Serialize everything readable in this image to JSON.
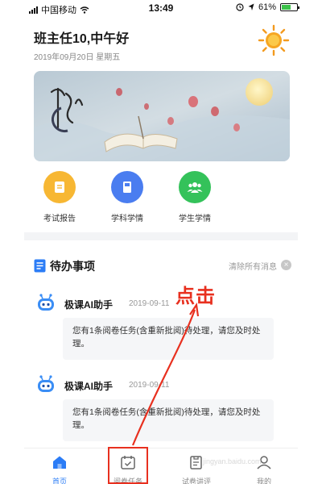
{
  "status_bar": {
    "carrier": "中国移动",
    "time": "13:49",
    "battery": "61%",
    "battery_level": 0.61
  },
  "header": {
    "greeting": "班主任10,中午好",
    "date": "2019年09月20日 星期五"
  },
  "banner": {
    "icon": "mid-autumn-banner"
  },
  "quick_actions": [
    {
      "label": "考试报告",
      "icon": "report-icon",
      "color": "#f7b733"
    },
    {
      "label": "学科学情",
      "icon": "book-icon",
      "color": "#4a7df0"
    },
    {
      "label": "学生学情",
      "icon": "students-icon",
      "color": "#34c25a"
    }
  ],
  "todo": {
    "title": "待办事项",
    "clear_all": "清除所有消息",
    "messages": [
      {
        "sender": "极课AI助手",
        "time": "2019-09-11",
        "text": "您有1条阅卷任务(含重新批阅)待处理，请您及时处理。"
      },
      {
        "sender": "极课AI助手",
        "time": "2019-09-11",
        "text": "您有1条阅卷任务(含重新批阅)待处理，请您及时处理。"
      }
    ]
  },
  "annotation": {
    "text": "点击",
    "color": "#e8301f"
  },
  "tabbar": {
    "tabs": [
      {
        "label": "首页",
        "icon": "home-icon",
        "active": true
      },
      {
        "label": "阅卷任务",
        "icon": "calendar-check-icon",
        "active": false
      },
      {
        "label": "试卷讲评",
        "icon": "paper-review-icon",
        "active": false
      },
      {
        "label": "我的",
        "icon": "user-icon",
        "active": false
      }
    ],
    "accent": "#2b7cf6"
  },
  "watermark": "jingyan.baidu.com"
}
